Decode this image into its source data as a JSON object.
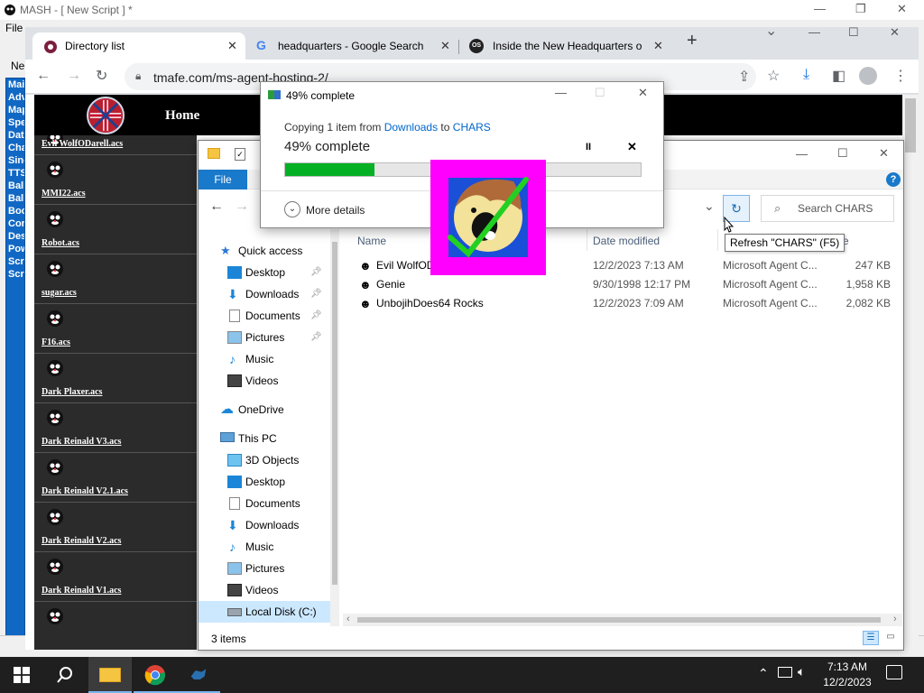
{
  "mash": {
    "title": "MASH - [ New Script ] *",
    "menu_file": "File",
    "toolbar_new": "Ne",
    "left_items": [
      "Mai",
      "Adv",
      "Map",
      "Spe",
      "Dat",
      "Cha",
      "Sing",
      "TTS",
      "Ball",
      "Ball",
      "Boo",
      "Cor",
      "Des",
      "Pow",
      "Scr",
      "Scr"
    ]
  },
  "browser": {
    "tabs": [
      {
        "label": "Directory list",
        "active": true
      },
      {
        "label": "headquarters - Google Search",
        "active": false
      },
      {
        "label": "Inside the New Headquarters o",
        "active": false
      }
    ],
    "new_tab": "+",
    "url": "tmafe.com/ms-agent-hosting-2/"
  },
  "website": {
    "nav_home": "Home",
    "agents": [
      "Evil WolfODarell.acs",
      "MMI22.acs",
      "Robot.acs",
      "sugar.acs",
      "F16.acs",
      "Dark Plaxer.acs",
      "Dark Reinald V3.acs",
      "Dark Reinald V2.1.acs",
      "Dark Reinald V2.acs",
      "Dark Reinald V1.acs",
      ""
    ]
  },
  "explorer": {
    "file_tab": "File",
    "help": "?",
    "search_placeholder": "Search CHARS",
    "tooltip": "Refresh \"CHARS\" (F5)",
    "nav": [
      {
        "label": "Quick access",
        "icon": "star-icon",
        "indent": 1,
        "pinned": false
      },
      {
        "label": "Desktop",
        "icon": "desktop-icon",
        "indent": 2,
        "pinned": true
      },
      {
        "label": "Downloads",
        "icon": "downloads-icon",
        "indent": 2,
        "pinned": true
      },
      {
        "label": "Documents",
        "icon": "documents-icon",
        "indent": 2,
        "pinned": true
      },
      {
        "label": "Pictures",
        "icon": "pictures-icon",
        "indent": 2,
        "pinned": true
      },
      {
        "label": "Music",
        "icon": "music-icon",
        "indent": 2,
        "pinned": false
      },
      {
        "label": "Videos",
        "icon": "videos-icon",
        "indent": 2,
        "pinned": false
      },
      {
        "label": "OneDrive",
        "icon": "cloud-icon",
        "indent": 1,
        "pinned": false
      },
      {
        "label": "This PC",
        "icon": "computer-icon",
        "indent": 1,
        "pinned": false
      },
      {
        "label": "3D Objects",
        "icon": "cube-icon",
        "indent": 2,
        "pinned": false
      },
      {
        "label": "Desktop",
        "icon": "desktop-icon",
        "indent": 2,
        "pinned": false
      },
      {
        "label": "Documents",
        "icon": "documents-icon",
        "indent": 2,
        "pinned": false
      },
      {
        "label": "Downloads",
        "icon": "downloads-icon",
        "indent": 2,
        "pinned": false
      },
      {
        "label": "Music",
        "icon": "music-icon",
        "indent": 2,
        "pinned": false
      },
      {
        "label": "Pictures",
        "icon": "pictures-icon",
        "indent": 2,
        "pinned": false
      },
      {
        "label": "Videos",
        "icon": "videos-icon",
        "indent": 2,
        "pinned": false
      },
      {
        "label": "Local Disk (C:)",
        "icon": "disk-icon",
        "indent": 2,
        "pinned": false,
        "selected": true
      }
    ],
    "columns": {
      "name": "Name",
      "date": "Date modified",
      "type": "",
      "size": "ze"
    },
    "files": [
      {
        "name": "Evil WolfOD",
        "date": "12/2/2023 7:13 AM",
        "type": "Microsoft Agent C...",
        "size": "247 KB"
      },
      {
        "name": "Genie",
        "date": "9/30/1998 12:17 PM",
        "type": "Microsoft Agent C...",
        "size": "1,958 KB"
      },
      {
        "name": "UnbojihDoes64 Rocks",
        "date": "12/2/2023 7:09 AM",
        "type": "Microsoft Agent C...",
        "size": "2,082 KB"
      }
    ],
    "status_items": "3 items"
  },
  "copy_dialog": {
    "title": "49% complete",
    "from_prefix": "Copying 1 item from ",
    "from_src": "Downloads",
    "from_mid": " to ",
    "from_dst": "CHARS",
    "percent_text": "49% complete",
    "progress": 0.25,
    "pause": "II",
    "cancel": "✕",
    "more_details": "More details"
  },
  "taskbar": {
    "time": "7:13 AM",
    "date": "12/2/2023"
  },
  "colors": {
    "progress_green": "#06b025",
    "explorer_blue": "#1979ca",
    "sticker_magenta": "#ff00ff"
  }
}
